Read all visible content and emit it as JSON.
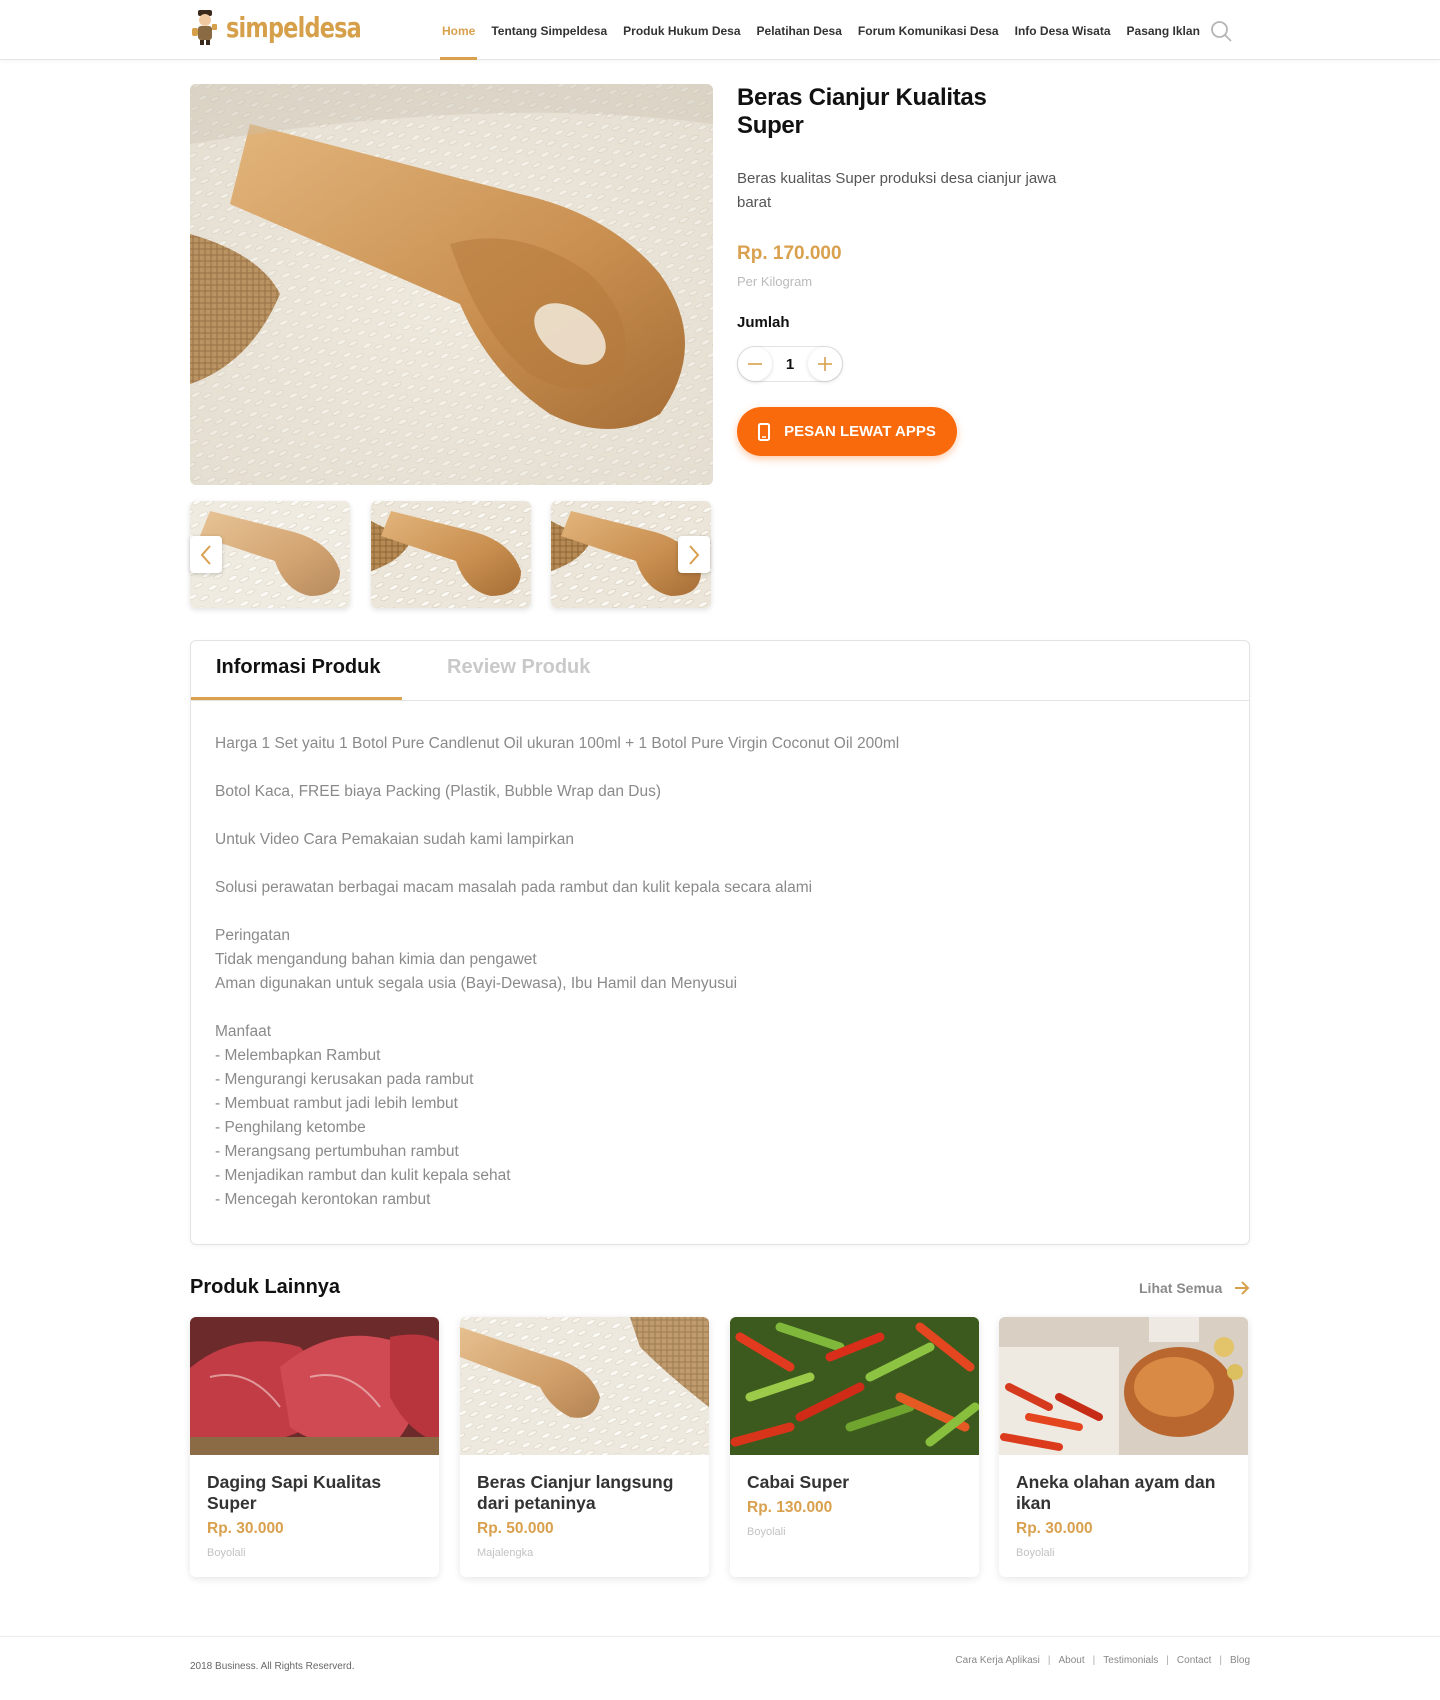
{
  "brand": {
    "name": "simpeldesa"
  },
  "nav": {
    "items": [
      {
        "label": "Home",
        "active": true
      },
      {
        "label": "Tentang Simpeldesa"
      },
      {
        "label": "Produk Hukum Desa"
      },
      {
        "label": "Pelatihan Desa"
      },
      {
        "label": "Forum Komunikasi Desa"
      },
      {
        "label": "Info Desa Wisata"
      },
      {
        "label": "Pasang Iklan"
      }
    ],
    "search_icon": "search-icon"
  },
  "product": {
    "title": "Beras Cianjur Kualitas Super",
    "description": "Beras kualitas Super produksi desa cianjur jawa barat",
    "price": "Rp. 170.000",
    "unit": "Per Kilogram",
    "quantity_label": "Jumlah",
    "quantity": "1",
    "order_button": "PESAN LEWAT APPS"
  },
  "tabs": {
    "items": [
      {
        "label": "Informasi Produk",
        "active": true
      },
      {
        "label": "Review Produk"
      }
    ],
    "content": {
      "p1": "Harga 1 Set yaitu 1 Botol Pure Candlenut Oil ukuran 100ml + 1 Botol Pure Virgin Coconut Oil 200ml",
      "p2": "Botol Kaca, FREE biaya Packing (Plastik, Bubble Wrap dan Dus)",
      "p3": "Untuk Video Cara Pemakaian sudah kami lampirkan",
      "p4": "Solusi perawatan berbagai macam masalah pada rambut dan kulit kepala secara alami",
      "warning_title": "Peringatan",
      "warning_lines": [
        "Tidak mengandung bahan kimia dan pengawet",
        "Aman digunakan untuk segala usia (Bayi-Dewasa), Ibu Hamil dan Menyusui"
      ],
      "benefit_title": "Manfaat",
      "benefit_lines": [
        "- Melembapkan Rambut",
        "- Mengurangi kerusakan pada rambut",
        "- Membuat rambut jadi lebih lembut",
        "- Penghilang ketombe",
        "- Merangsang pertumbuhan rambut",
        "- Menjadikan rambut dan kulit kepala sehat",
        "- Mencegah kerontokan rambut"
      ]
    }
  },
  "related": {
    "title": "Produk Lainnya",
    "see_all": "Lihat Semua",
    "items": [
      {
        "title": "Daging Sapi Kualitas Super",
        "price": "Rp. 30.000",
        "location": "Boyolali"
      },
      {
        "title": "Beras Cianjur langsung dari petaninya",
        "price": "Rp. 50.000",
        "location": "Majalengka"
      },
      {
        "title": "Cabai Super",
        "price": "Rp. 130.000",
        "location": "Boyolali"
      },
      {
        "title": "Aneka olahan ayam dan ikan",
        "price": "Rp. 30.000",
        "location": "Boyolali"
      }
    ]
  },
  "footer": {
    "copyright": "2018 Business. All Rights Reserverd.",
    "links": [
      "Cara Kerja Aplikasi",
      "About",
      "Testimonials",
      "Contact",
      "Blog"
    ]
  },
  "colors": {
    "accent": "#d9a04e",
    "cta": "#f96a0c"
  }
}
